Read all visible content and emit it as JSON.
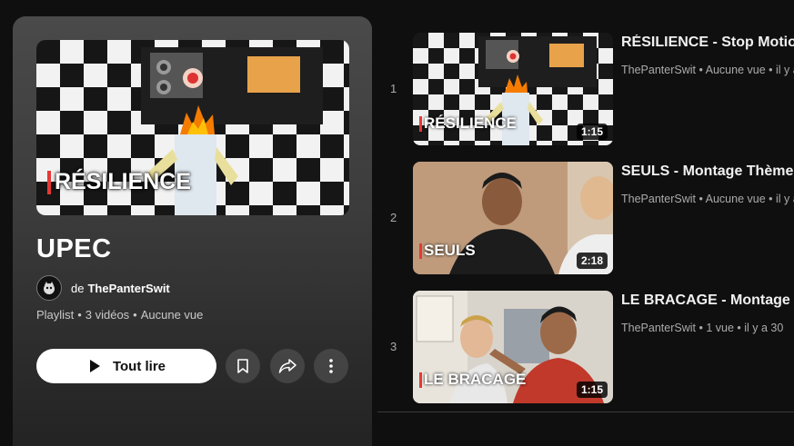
{
  "playlist": {
    "title": "UPEC",
    "owner_prefix": "de",
    "owner_name": "ThePanterSwit",
    "meta_type": "Playlist",
    "meta_count": "3 vidéos",
    "meta_views": "Aucune vue",
    "play_all_label": "Tout lire",
    "hero_caption": "RÉSILIENCE"
  },
  "videos": [
    {
      "index": "1",
      "title": "RÉSILIENCE - Stop Motion",
      "channel": "ThePanterSwit",
      "stats": "Aucune vue • il y a",
      "duration": "1:15",
      "thumb_caption": "RÉSILIENCE"
    },
    {
      "index": "2",
      "title": "SEULS - Montage Thème",
      "channel": "ThePanterSwit",
      "stats": "Aucune vue • il y a",
      "duration": "2:18",
      "thumb_caption": "SEULS"
    },
    {
      "index": "3",
      "title": "LE BRACAGE - Montage",
      "channel": "ThePanterSwit",
      "stats": "1 vue • il y a 30",
      "duration": "1:15",
      "thumb_caption": "LE BRACAGE"
    }
  ],
  "icons": {
    "play": "play-icon",
    "save": "bookmark-icon",
    "share": "share-icon",
    "more": "more-vert-icon"
  },
  "colors": {
    "background": "#0f0f0f",
    "card_top": "#4a4a4a",
    "accent_red": "#e53935",
    "text_secondary": "#aaaaaa"
  }
}
